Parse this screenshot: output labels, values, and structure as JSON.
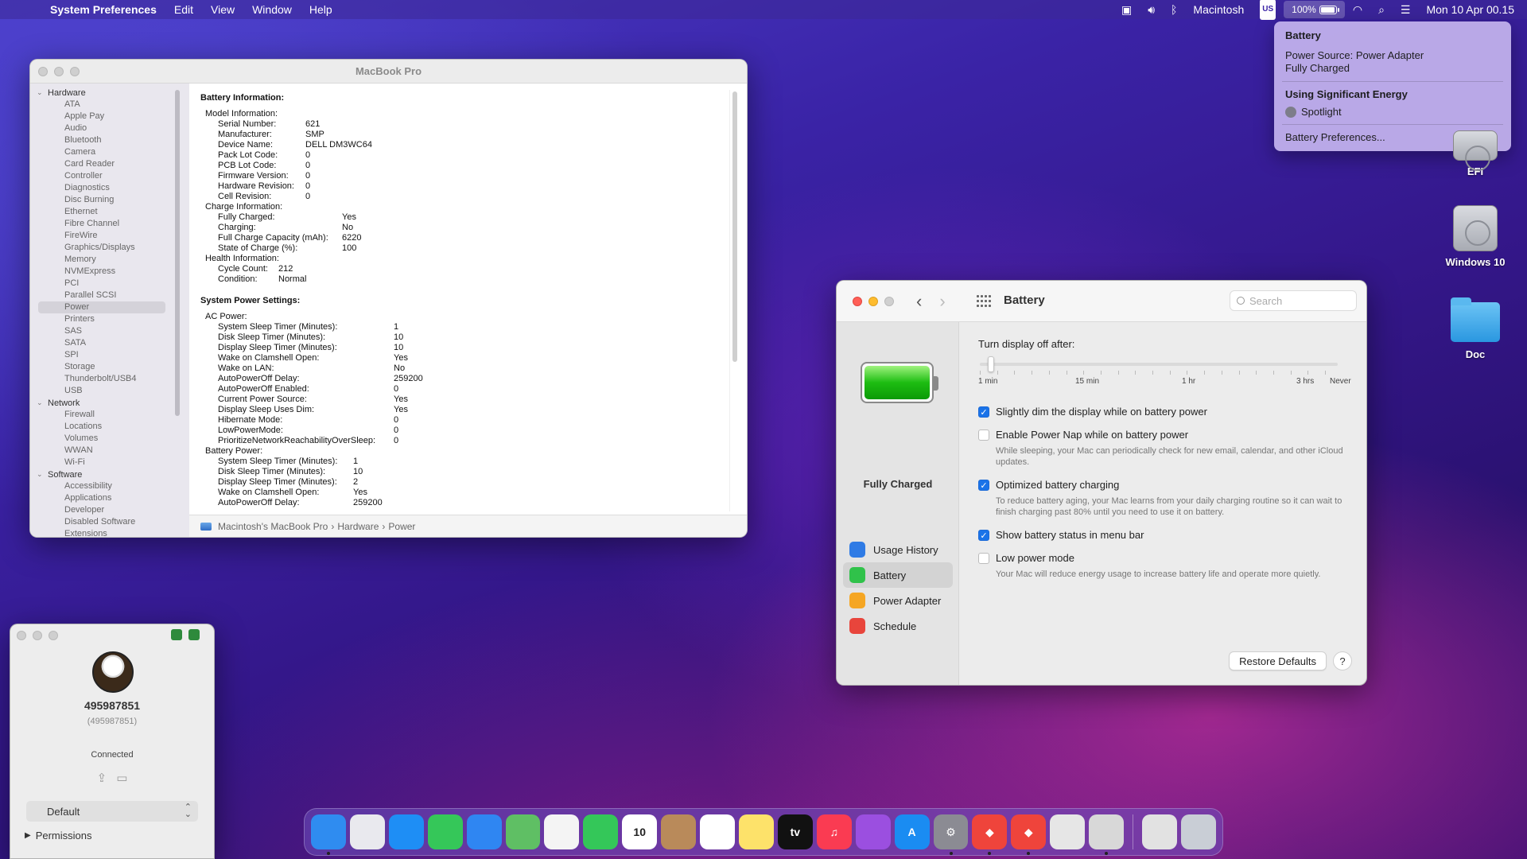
{
  "menubar": {
    "app_name": "System Preferences",
    "menus": [
      "Edit",
      "View",
      "Window",
      "Help"
    ],
    "user": "Macintosh",
    "keyboard": "US",
    "battery_percent": "100%",
    "clock": "Mon 10 Apr  00.15"
  },
  "battery_menu": {
    "title": "Battery",
    "power_source": "Power Source: Power Adapter",
    "status": "Fully Charged",
    "energy_header": "Using Significant Energy",
    "energy_app": "Spotlight",
    "prefs_link": "Battery Preferences..."
  },
  "desktop": {
    "icons": [
      {
        "label": "EFI"
      },
      {
        "label": "Windows 10"
      },
      {
        "label": "Doc"
      }
    ]
  },
  "sysinfo": {
    "title": "MacBook Pro",
    "sidebar": {
      "hardware_label": "Hardware",
      "hardware_items": [
        "ATA",
        "Apple Pay",
        "Audio",
        "Bluetooth",
        "Camera",
        "Card Reader",
        "Controller",
        "Diagnostics",
        "Disc Burning",
        "Ethernet",
        "Fibre Channel",
        "FireWire",
        "Graphics/Displays",
        "Memory",
        "NVMExpress",
        "PCI",
        "Parallel SCSI",
        "Power",
        "Printers",
        "SAS",
        "SATA",
        "SPI",
        "Storage",
        "Thunderbolt/USB4",
        "USB"
      ],
      "network_label": "Network",
      "network_items": [
        "Firewall",
        "Locations",
        "Volumes",
        "WWAN",
        "Wi-Fi"
      ],
      "software_label": "Software",
      "software_items": [
        "Accessibility",
        "Applications",
        "Developer",
        "Disabled Software",
        "Extensions"
      ],
      "selected": "Power"
    },
    "battery_info_title": "Battery Information:",
    "model_info_label": "Model Information:",
    "model_info": [
      {
        "k": "Serial Number:",
        "v": "621"
      },
      {
        "k": "Manufacturer:",
        "v": "SMP"
      },
      {
        "k": "Device Name:",
        "v": "DELL DM3WC64"
      },
      {
        "k": "Pack Lot Code:",
        "v": "0"
      },
      {
        "k": "PCB Lot Code:",
        "v": "0"
      },
      {
        "k": "Firmware Version:",
        "v": "0"
      },
      {
        "k": "Hardware Revision:",
        "v": "0"
      },
      {
        "k": "Cell Revision:",
        "v": "0"
      }
    ],
    "charge_info_label": "Charge Information:",
    "charge_info": [
      {
        "k": "Fully Charged:",
        "v": "Yes"
      },
      {
        "k": "Charging:",
        "v": "No"
      },
      {
        "k": "Full Charge Capacity (mAh):",
        "v": "6220"
      },
      {
        "k": "State of Charge (%):",
        "v": "100"
      }
    ],
    "health_info_label": "Health Information:",
    "health_info": [
      {
        "k": "Cycle Count:",
        "v": "212"
      },
      {
        "k": "Condition:",
        "v": "Normal"
      }
    ],
    "power_settings_title": "System Power Settings:",
    "ac_power_label": "AC Power:",
    "ac_power": [
      {
        "k": "System Sleep Timer (Minutes):",
        "v": "1"
      },
      {
        "k": "Disk Sleep Timer (Minutes):",
        "v": "10"
      },
      {
        "k": "Display Sleep Timer (Minutes):",
        "v": "10"
      },
      {
        "k": "Wake on Clamshell Open:",
        "v": "Yes"
      },
      {
        "k": "Wake on LAN:",
        "v": "No"
      },
      {
        "k": "AutoPowerOff Delay:",
        "v": "259200"
      },
      {
        "k": "AutoPowerOff Enabled:",
        "v": "0"
      },
      {
        "k": "Current Power Source:",
        "v": "Yes"
      },
      {
        "k": "Display Sleep Uses Dim:",
        "v": "Yes"
      },
      {
        "k": "Hibernate Mode:",
        "v": "0"
      },
      {
        "k": "LowPowerMode:",
        "v": "0"
      },
      {
        "k": "PrioritizeNetworkReachabilityOverSleep:",
        "v": "0"
      }
    ],
    "battery_power_label": "Battery Power:",
    "battery_power": [
      {
        "k": "System Sleep Timer (Minutes):",
        "v": "1"
      },
      {
        "k": "Disk Sleep Timer (Minutes):",
        "v": "10"
      },
      {
        "k": "Display Sleep Timer (Minutes):",
        "v": "2"
      },
      {
        "k": "Wake on Clamshell Open:",
        "v": "Yes"
      },
      {
        "k": "AutoPowerOff Delay:",
        "v": "259200"
      }
    ],
    "path": [
      "Macintosh's MacBook Pro",
      "Hardware",
      "Power"
    ]
  },
  "prefs": {
    "title": "Battery",
    "search_placeholder": "Search",
    "status": "Fully Charged",
    "nav": [
      {
        "label": "Usage History",
        "color": "#2f7be5"
      },
      {
        "label": "Battery",
        "color": "#30c24a"
      },
      {
        "label": "Power Adapter",
        "color": "#f5a623"
      },
      {
        "label": "Schedule",
        "color": "#e8453c"
      }
    ],
    "selected_nav": "Battery",
    "slider_label": "Turn display off after:",
    "slider_value": "1 min",
    "slider_ticks": [
      "1 min",
      "15 min",
      "1 hr",
      "3 hrs",
      "Never"
    ],
    "options": [
      {
        "label": "Slightly dim the display while on battery power",
        "checked": true,
        "desc": ""
      },
      {
        "label": "Enable Power Nap while on battery power",
        "checked": false,
        "desc": "While sleeping, your Mac can periodically check for new email, calendar, and other iCloud updates."
      },
      {
        "label": "Optimized battery charging",
        "checked": true,
        "desc": "To reduce battery aging, your Mac learns from your daily charging routine so it can wait to finish charging past 80% until you need to use it on battery."
      },
      {
        "label": "Show battery status in menu bar",
        "checked": true,
        "desc": ""
      },
      {
        "label": "Low power mode",
        "checked": false,
        "desc": "Your Mac will reduce energy usage to increase battery life and operate more quietly."
      }
    ],
    "restore_label": "Restore Defaults",
    "help_label": "?"
  },
  "remote": {
    "id": "495987851",
    "alias": "(495987851)",
    "status": "Connected",
    "profile": "Default",
    "permissions": "Permissions"
  },
  "dock": {
    "apps": [
      {
        "name": "finder-icon",
        "color": "#2f8cf0",
        "glyph": "",
        "running": true
      },
      {
        "name": "launchpad-icon",
        "color": "#e9e9ee",
        "glyph": "",
        "running": false
      },
      {
        "name": "safari-icon",
        "color": "#1e8ef5",
        "glyph": "",
        "running": false
      },
      {
        "name": "messages-icon",
        "color": "#35c759",
        "glyph": "",
        "running": false
      },
      {
        "name": "mail-icon",
        "color": "#2f86f2",
        "glyph": "",
        "running": false
      },
      {
        "name": "maps-icon",
        "color": "#5fbf64",
        "glyph": "",
        "running": false
      },
      {
        "name": "photos-icon",
        "color": "#f4f4f4",
        "glyph": "",
        "running": false
      },
      {
        "name": "facetime-icon",
        "color": "#34c759",
        "glyph": "",
        "running": false
      },
      {
        "name": "calendar-icon",
        "color": "#ffffff",
        "glyph": "10",
        "running": false
      },
      {
        "name": "contacts-icon",
        "color": "#b98a5a",
        "glyph": "",
        "running": false
      },
      {
        "name": "reminders-icon",
        "color": "#ffffff",
        "glyph": "",
        "running": false
      },
      {
        "name": "notes-icon",
        "color": "#fde26a",
        "glyph": "",
        "running": false
      },
      {
        "name": "apple-tv-icon",
        "color": "#111111",
        "glyph": "tv",
        "running": false
      },
      {
        "name": "music-icon",
        "color": "#fa3b52",
        "glyph": "♫",
        "running": false
      },
      {
        "name": "podcasts-icon",
        "color": "#9b4fe0",
        "glyph": "",
        "running": false
      },
      {
        "name": "app-store-icon",
        "color": "#1a8cf2",
        "glyph": "A",
        "running": false
      },
      {
        "name": "system-preferences-icon",
        "color": "#8b8b93",
        "glyph": "⚙",
        "running": true
      },
      {
        "name": "anydesk-icon",
        "color": "#ef443b",
        "glyph": "◆",
        "running": true
      },
      {
        "name": "anydesk-2-icon",
        "color": "#ef443b",
        "glyph": "◆",
        "running": true
      },
      {
        "name": "textedit-icon",
        "color": "#e6e6e6",
        "glyph": "",
        "running": false
      },
      {
        "name": "system-information-icon",
        "color": "#d8d8d8",
        "glyph": "",
        "running": true
      },
      {
        "name": "document-icon",
        "color": "#e2e2e2",
        "glyph": "",
        "running": false
      },
      {
        "name": "trash-icon",
        "color": "#c9ced6",
        "glyph": "",
        "running": false
      }
    ]
  }
}
